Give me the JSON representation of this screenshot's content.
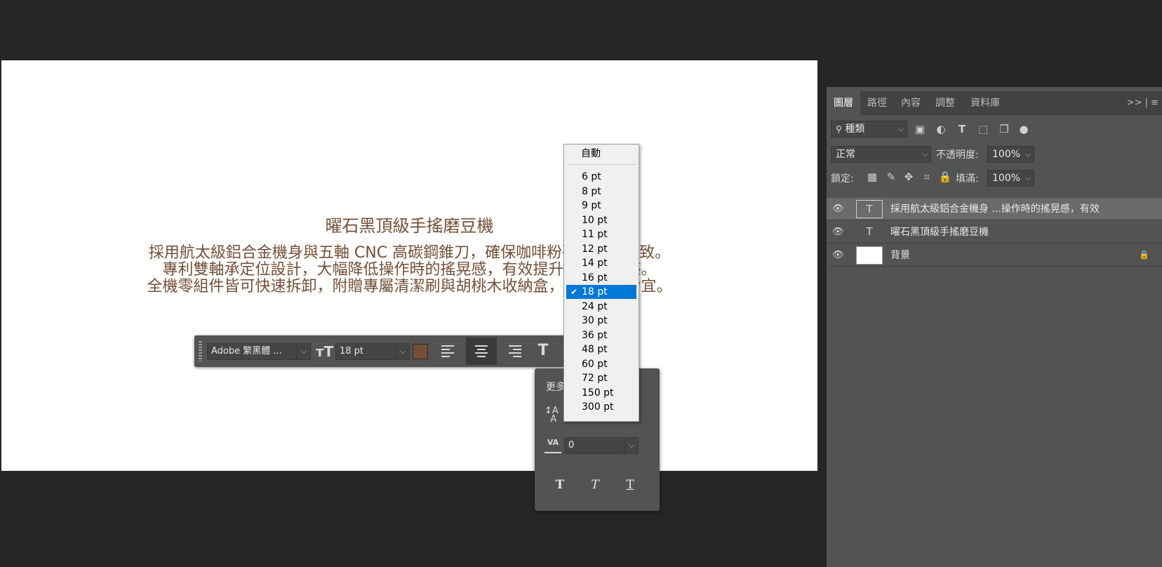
{
  "canvas": {
    "title": "曜石黑頂級手搖磨豆機",
    "body_lines": [
      "採用航太級鋁合金機身與五軸 CNC 高碳鋼錐刀，確保咖啡粉研磨均勻一致。",
      "專利雙軸承定位設計，大幅降低操作時的搖晃感，有效提升研磨順手感。",
      "全機零組件皆可快速拆卸，附贈專屬清潔刷與胡桃木收納盒，居家戶外皆宜。"
    ],
    "text_color": "#744f35"
  },
  "context_bar": {
    "font_family": "Adobe 繁黑體 ...",
    "font_size": "18 pt",
    "color_swatch": "#744f35",
    "align_active": "center"
  },
  "size_dropdown": {
    "auto_label": "自動",
    "options": [
      "6 pt",
      "8 pt",
      "9 pt",
      "10 pt",
      "11 pt",
      "12 pt",
      "14 pt",
      "16 pt",
      "18 pt",
      "24 pt",
      "30 pt",
      "36 pt",
      "48 pt",
      "60 pt",
      "72 pt",
      "150 pt",
      "300 pt"
    ],
    "selected": "18 pt",
    "check": "✔"
  },
  "more_options": {
    "title": "更多",
    "tracking_value": "0",
    "style_buttons": [
      "T",
      "T",
      "T"
    ]
  },
  "panel": {
    "tabs": [
      "圖層",
      "路徑",
      "內容",
      "調整",
      "資料庫"
    ],
    "active_tab": "圖層",
    "menu_glyph": ">> | ≡",
    "filter_label": "種類",
    "blend_mode": "正常",
    "opacity_label": "不透明度:",
    "opacity_value": "100%",
    "lock_label": "鎖定:",
    "fill_label": "填滿:",
    "fill_value": "100%",
    "layers": [
      {
        "name": "採用航太級鋁合金機身 ...操作時的搖晃感，有效",
        "thumb": "T",
        "selected": true
      },
      {
        "name": "曜石黑頂級手搖磨豆機",
        "thumb": "T",
        "selected": false
      },
      {
        "name": "背景",
        "thumb": "",
        "selected": false,
        "locked": true
      }
    ]
  }
}
